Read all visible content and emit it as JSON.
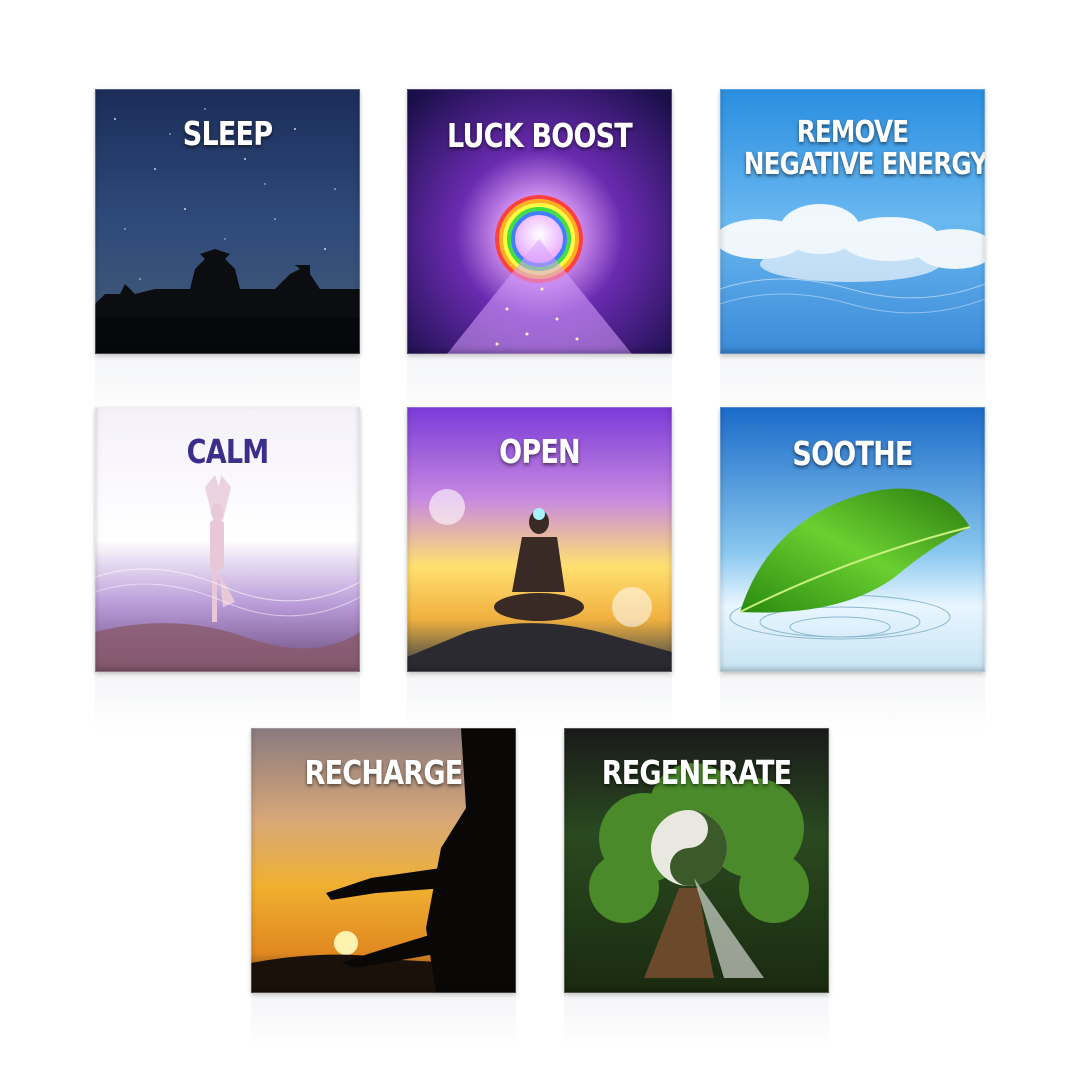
{
  "tiles": [
    {
      "label": "SLEEP"
    },
    {
      "label": "LUCK BOOST"
    },
    {
      "label_line1": "REMOVE",
      "label_line2": "NEGATIVE ENERGY"
    },
    {
      "label": "CALM"
    },
    {
      "label": "OPEN"
    },
    {
      "label": "SOOTHE"
    },
    {
      "label": "RECHARGE"
    },
    {
      "label": "REGENERATE"
    }
  ],
  "colors": {
    "background": "#ffffff",
    "label_text": "#ffffff",
    "calm_label": "#3a2f8a"
  }
}
